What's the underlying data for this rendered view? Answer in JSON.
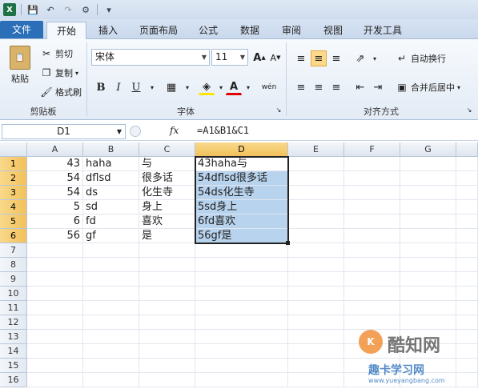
{
  "quick_access": {
    "icons": [
      "save-icon",
      "undo-icon",
      "redo-icon",
      "tool-icon",
      "customize-icon"
    ]
  },
  "tabs": [
    {
      "label": "文件",
      "kind": "file"
    },
    {
      "label": "开始",
      "kind": "active"
    },
    {
      "label": "插入"
    },
    {
      "label": "页面布局"
    },
    {
      "label": "公式"
    },
    {
      "label": "数据"
    },
    {
      "label": "审阅"
    },
    {
      "label": "视图"
    },
    {
      "label": "开发工具"
    }
  ],
  "ribbon": {
    "clipboard": {
      "paste": "粘贴",
      "cut": "剪切",
      "copy": "复制",
      "format_painter": "格式刷",
      "label": "剪贴板"
    },
    "font": {
      "name": "宋体",
      "size": "11",
      "label": "字体",
      "bold": "B",
      "italic": "I",
      "underline": "U",
      "grow": "A",
      "shrink": "A",
      "wen": "wén"
    },
    "alignment": {
      "wrap": "自动换行",
      "merge": "合并后居中",
      "label": "对齐方式"
    }
  },
  "formula_bar": {
    "name_box": "D1",
    "fx": "fx",
    "formula": "=A1&B1&C1"
  },
  "grid": {
    "columns": [
      "A",
      "B",
      "C",
      "D",
      "E",
      "F",
      "G"
    ],
    "selected_column": "D",
    "rows": [
      "1",
      "2",
      "3",
      "4",
      "5",
      "6",
      "7",
      "8",
      "9",
      "10",
      "11",
      "12",
      "13",
      "14",
      "15",
      "16"
    ],
    "selected_rows": [
      "1",
      "2",
      "3",
      "4",
      "5",
      "6"
    ],
    "data": [
      {
        "A": "43",
        "B": "haha",
        "C": "与",
        "D": "43haha与"
      },
      {
        "A": "54",
        "B": "dflsd",
        "C": "很多话",
        "D": "54dflsd很多话"
      },
      {
        "A": "54",
        "B": "ds",
        "C": "化生寺",
        "D": "54ds化生寺"
      },
      {
        "A": "5",
        "B": "sd",
        "C": "身上",
        "D": "5sd身上"
      },
      {
        "A": "6",
        "B": "fd",
        "C": "喜欢",
        "D": "6fd喜欢"
      },
      {
        "A": "56",
        "B": "gf",
        "C": "是",
        "D": "56gf是"
      }
    ]
  },
  "watermark": {
    "brand": "酷知网",
    "site": "趣卡学习网",
    "url": "www.yueyangbang.com"
  }
}
